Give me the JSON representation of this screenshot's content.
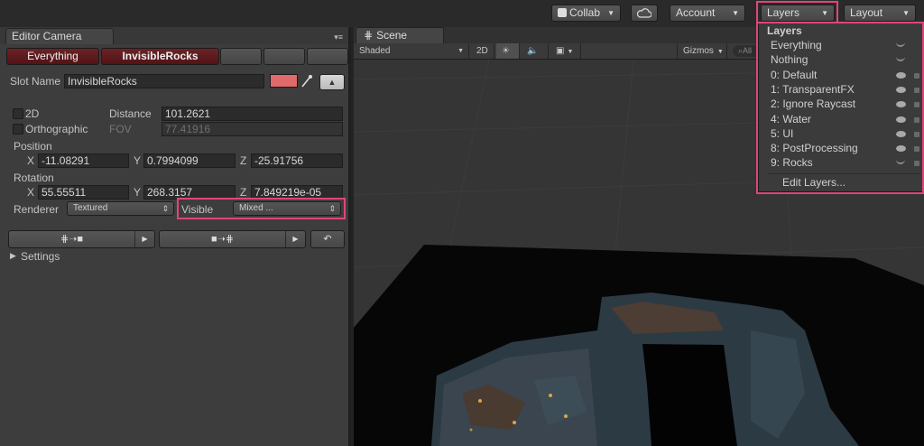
{
  "topbar": {
    "collab_label": "Collab",
    "account_label": "Account",
    "layers_label": "Layers",
    "layout_label": "Layout"
  },
  "inspector": {
    "tab_title": "Editor Camera",
    "buttons": [
      "Everything",
      "InvisibleRocks"
    ],
    "slot_name_label": "Slot Name",
    "slot_name_value": "InvisibleRocks",
    "slot_color": "#e06a6a",
    "twod_label": "2D",
    "orthographic_label": "Orthographic",
    "distance_label": "Distance",
    "distance_value": "101.2621",
    "fov_label": "FOV",
    "fov_value": "77.41916",
    "position_label": "Position",
    "position": {
      "x": "-11.08291",
      "y": "0.7994099",
      "z": "-25.91756"
    },
    "rotation_label": "Rotation",
    "rotation": {
      "x": "55.55511",
      "y": "268.3157",
      "z": "7.849219e-05"
    },
    "axis_x": "X",
    "axis_y": "Y",
    "axis_z": "Z",
    "renderer_label": "Renderer",
    "renderer_value": "Textured",
    "visible_label": "Visible",
    "visible_value": "Mixed ...",
    "settings_label": "Settings"
  },
  "scene": {
    "tab_title": "Scene",
    "shading_mode": "Shaded",
    "twod_toggle": "2D",
    "gizmos_label": "Gizmos",
    "search_hint": "All"
  },
  "layers_menu": {
    "header": "Layers",
    "items": [
      {
        "label": "Everything",
        "eye": "off",
        "lock": false
      },
      {
        "label": "Nothing",
        "eye": "off",
        "lock": false
      },
      {
        "label": "0: Default",
        "eye": "on",
        "lock": true
      },
      {
        "label": "1: TransparentFX",
        "eye": "on",
        "lock": true
      },
      {
        "label": "2: Ignore Raycast",
        "eye": "on",
        "lock": true
      },
      {
        "label": "4: Water",
        "eye": "on",
        "lock": true
      },
      {
        "label": "5: UI",
        "eye": "on",
        "lock": true
      },
      {
        "label": "8: PostProcessing",
        "eye": "on",
        "lock": true
      },
      {
        "label": "9: Rocks",
        "eye": "off",
        "lock": true
      }
    ],
    "edit_label": "Edit Layers..."
  },
  "colors": {
    "highlight": "#e0457b",
    "red_button": "#5e1a1d"
  }
}
